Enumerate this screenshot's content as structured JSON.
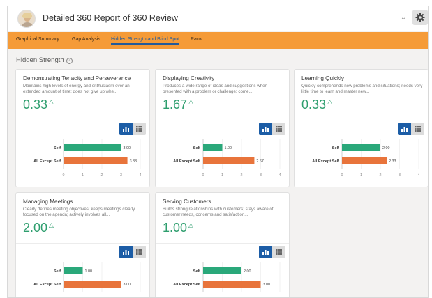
{
  "header": {
    "title": "Detailed 360 Report of 360 Review",
    "menu_icon": "chevron-down-icon",
    "settings_icon": "gear-icon"
  },
  "tabs": [
    {
      "label": "Graphical Summary",
      "active": false
    },
    {
      "label": "Gap Analysis",
      "active": false
    },
    {
      "label": "Hidden Strength and Blind Spot",
      "active": true
    },
    {
      "label": "Rank",
      "active": false
    }
  ],
  "section": {
    "title": "Hidden Strength",
    "info_icon": "?"
  },
  "colors": {
    "accent": "#f59b38",
    "score": "#2e9e6e",
    "self_bar": "#2aa87a",
    "others_bar": "#e8743b",
    "toggle_active": "#1c5da6"
  },
  "cards": [
    {
      "title": "Demonstrating Tenacity and Perseverance",
      "description": "Maintains high levels of energy and enthusiasm over an extended amount of time; does not give up whe...",
      "score": "0.33",
      "trend_icon": "△",
      "chart_data": {
        "type": "bar",
        "orientation": "horizontal",
        "categories": [
          "Self",
          "All Except Self"
        ],
        "values": [
          3.0,
          3.33
        ],
        "value_labels": [
          "3.00",
          "3.33"
        ],
        "xlim": [
          0,
          4
        ],
        "xticks": [
          "0",
          "1",
          "2",
          "3",
          "4"
        ]
      }
    },
    {
      "title": "Displaying Creativity",
      "description": "Produces a wide range of ideas and suggestions when presented with a problem or challenge; come...",
      "score": "1.67",
      "trend_icon": "△",
      "chart_data": {
        "type": "bar",
        "orientation": "horizontal",
        "categories": [
          "Self",
          "All Except Self"
        ],
        "values": [
          1.0,
          2.67
        ],
        "value_labels": [
          "1.00",
          "2.67"
        ],
        "xlim": [
          0,
          4
        ],
        "xticks": [
          "0",
          "1",
          "2",
          "3",
          "4"
        ]
      }
    },
    {
      "title": "Learning Quickly",
      "description": "Quickly comprehends new problems and situations; needs very little time to learn and master new...",
      "score": "0.33",
      "trend_icon": "△",
      "chart_data": {
        "type": "bar",
        "orientation": "horizontal",
        "categories": [
          "Self",
          "All Except Self"
        ],
        "values": [
          2.0,
          2.33
        ],
        "value_labels": [
          "2.00",
          "2.33"
        ],
        "xlim": [
          0,
          4
        ],
        "xticks": [
          "0",
          "1",
          "2",
          "3",
          "4"
        ]
      }
    },
    {
      "title": "Managing Meetings",
      "description": "Clearly defines meeting objectives; keeps meetings clearly focused on the agenda; actively involves all...",
      "score": "2.00",
      "trend_icon": "△",
      "chart_data": {
        "type": "bar",
        "orientation": "horizontal",
        "categories": [
          "Self",
          "All Except Self"
        ],
        "values": [
          1.0,
          3.0
        ],
        "value_labels": [
          "1.00",
          "3.00"
        ],
        "xlim": [
          0,
          4
        ],
        "xticks": [
          "0",
          "1",
          "2",
          "3",
          "4"
        ]
      }
    },
    {
      "title": "Serving Customers",
      "description": "Builds strong relationships with customers; stays aware of customer needs, concerns and satisfaction...",
      "score": "1.00",
      "trend_icon": "△",
      "chart_data": {
        "type": "bar",
        "orientation": "horizontal",
        "categories": [
          "Self",
          "All Except Self"
        ],
        "values": [
          2.0,
          3.0
        ],
        "value_labels": [
          "2.00",
          "3.00"
        ],
        "xlim": [
          0,
          4
        ],
        "xticks": [
          "0",
          "1",
          "2",
          "3",
          "4"
        ]
      }
    }
  ]
}
